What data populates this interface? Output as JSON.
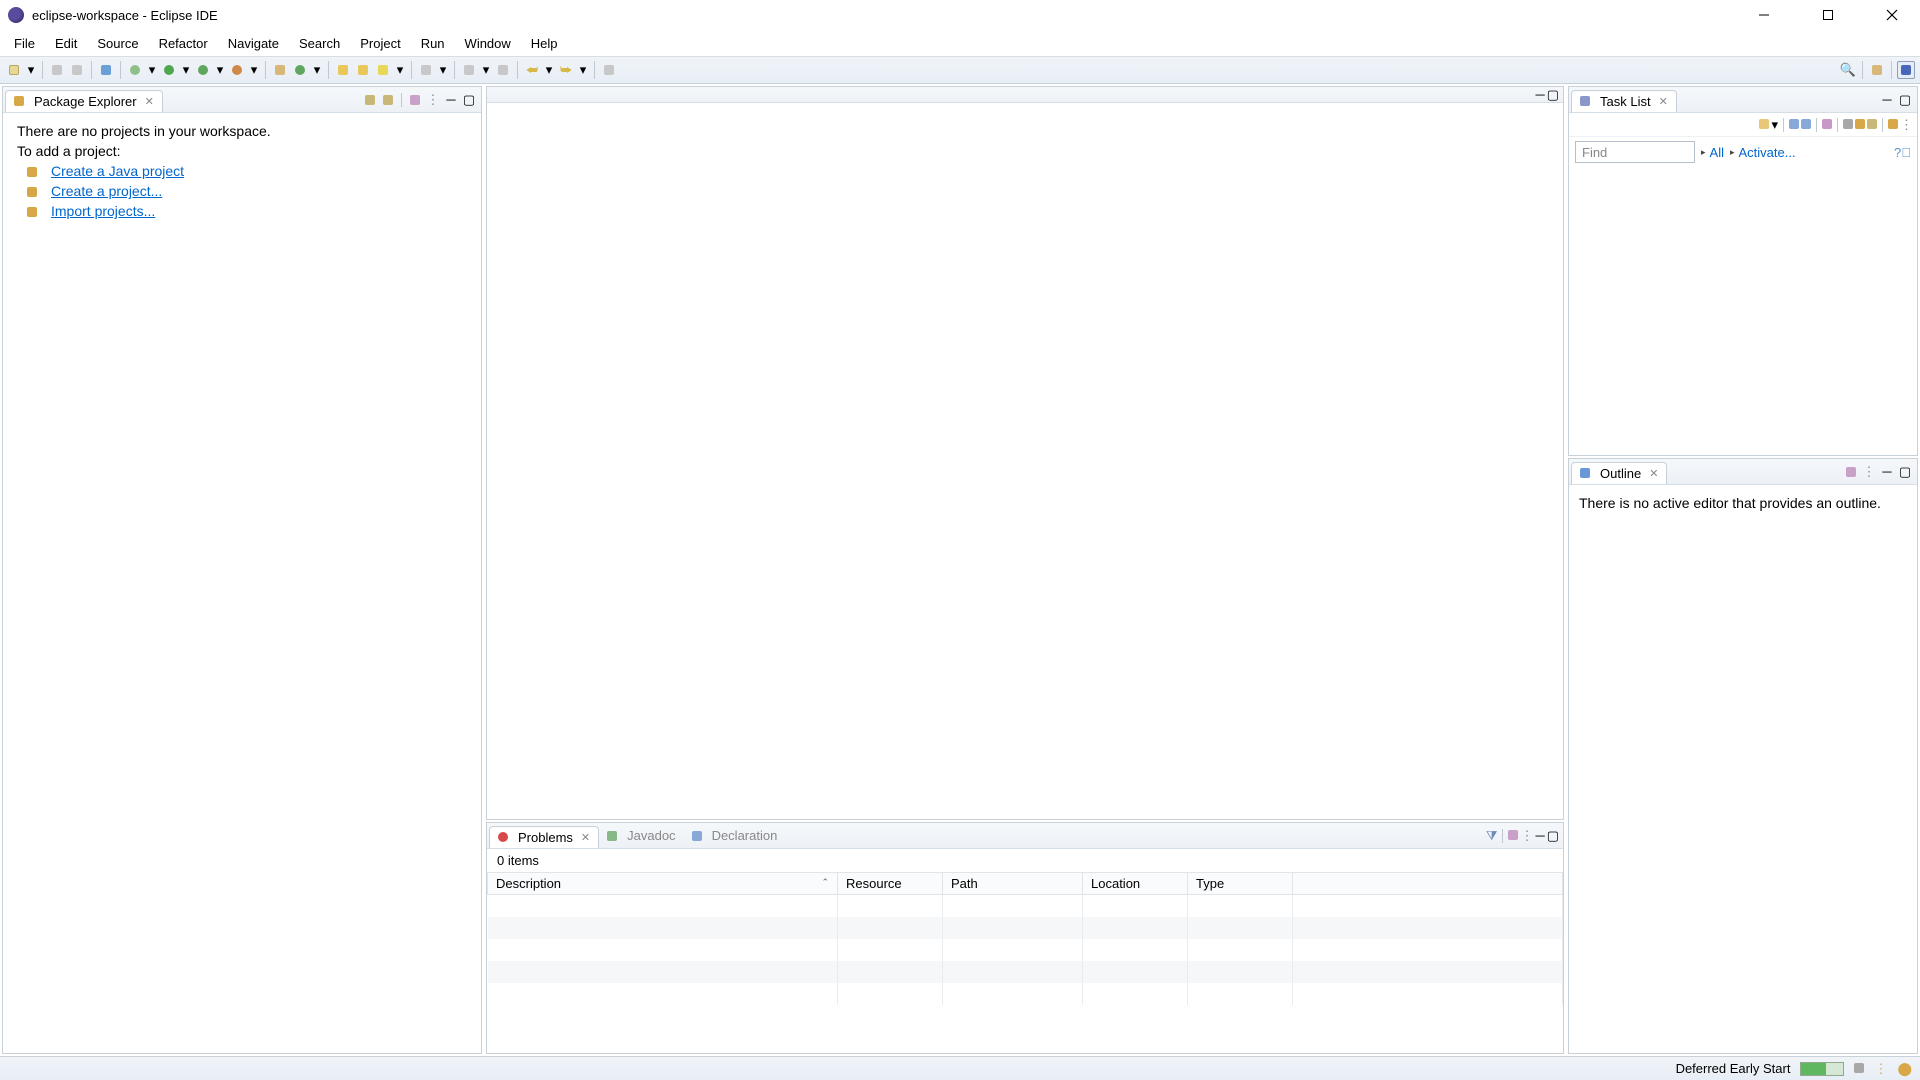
{
  "title": "eclipse-workspace - Eclipse IDE",
  "menu": [
    "File",
    "Edit",
    "Source",
    "Refactor",
    "Navigate",
    "Search",
    "Project",
    "Run",
    "Window",
    "Help"
  ],
  "packageExplorer": {
    "tabLabel": "Package Explorer",
    "emptyLine1": "There are no projects in your workspace.",
    "emptyLine2": "To add a project:",
    "links": [
      {
        "label": "Create a Java project"
      },
      {
        "label": "Create a project..."
      },
      {
        "label": "Import projects..."
      }
    ]
  },
  "taskList": {
    "tabLabel": "Task List",
    "findPlaceholder": "Find",
    "all": "All",
    "activate": "Activate..."
  },
  "outline": {
    "tabLabel": "Outline",
    "emptyText": "There is no active editor that provides an outline."
  },
  "problems": {
    "tabs": [
      "Problems",
      "Javadoc",
      "Declaration"
    ],
    "count": "0 items",
    "columns": [
      "Description",
      "Resource",
      "Path",
      "Location",
      "Type"
    ]
  },
  "status": {
    "deferred": "Deferred Early Start"
  }
}
